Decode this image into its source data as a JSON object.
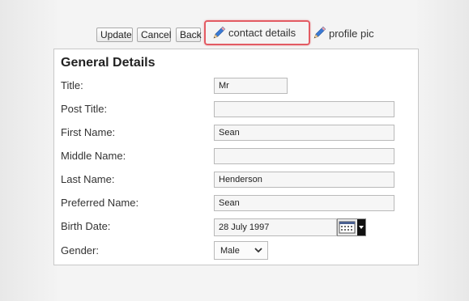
{
  "toolbar": {
    "update_label": "Update",
    "cancel_label": "Cancel",
    "back_label": "Back",
    "contact_details_label": "contact details",
    "profile_pic_label": "profile pic"
  },
  "form": {
    "section_title": "General Details",
    "fields": {
      "title": {
        "label": "Title:",
        "value": "Mr"
      },
      "post_title": {
        "label": "Post Title:",
        "value": ""
      },
      "first_name": {
        "label": "First Name:",
        "value": "Sean"
      },
      "middle_name": {
        "label": "Middle Name:",
        "value": ""
      },
      "last_name": {
        "label": "Last Name:",
        "value": "Henderson"
      },
      "preferred_name": {
        "label": "Preferred Name:",
        "value": "Sean"
      },
      "birth_date": {
        "label": "Birth Date:",
        "value": "28 July 1997"
      },
      "gender": {
        "label": "Gender:",
        "value": "Male"
      }
    }
  },
  "colors": {
    "highlight_border": "#e35b63",
    "pencil_blue": "#3a7bd5"
  },
  "icons": {
    "edit": "pencil-icon",
    "calendar": "calendar-icon",
    "dropdown": "chevron-down-icon"
  }
}
